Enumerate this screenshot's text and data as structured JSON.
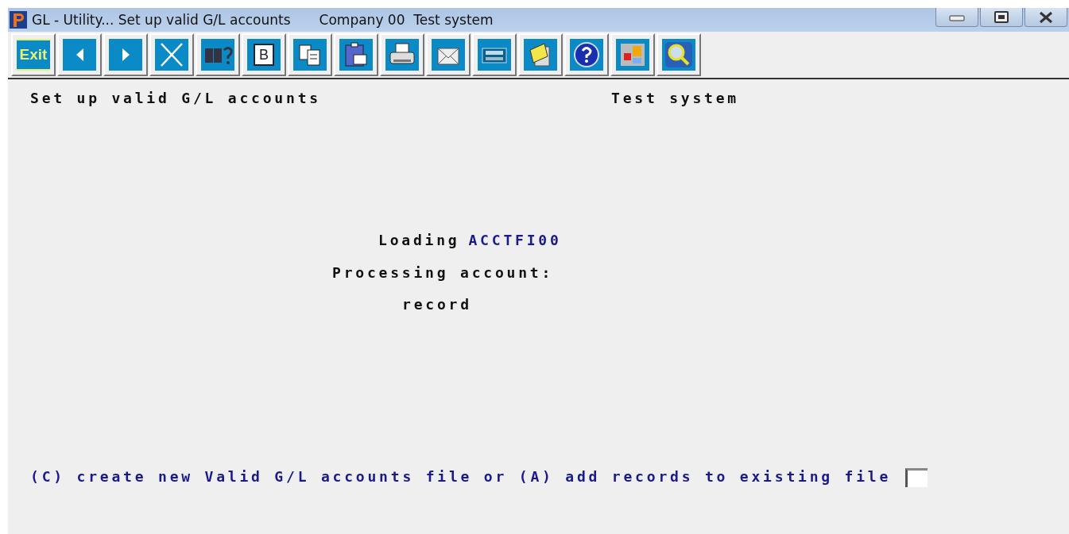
{
  "window": {
    "title": "GL - Utility... Set up valid G/L accounts",
    "company": "Company 00  Test system"
  },
  "toolbar": [
    {
      "kind": "text",
      "label": "Exit"
    },
    {
      "kind": "icon"
    },
    {
      "kind": "icon"
    },
    {
      "kind": "icon"
    },
    {
      "kind": "icon"
    },
    {
      "kind": "letter",
      "label": "B"
    },
    {
      "kind": "icon"
    },
    {
      "kind": "icon"
    },
    {
      "kind": "icon"
    },
    {
      "kind": "icon"
    },
    {
      "kind": "icon"
    },
    {
      "kind": "icon"
    },
    {
      "kind": "icon"
    },
    {
      "kind": "icon"
    },
    {
      "kind": "icon"
    }
  ],
  "screen": {
    "heading": "Set up valid G/L accounts",
    "system": "Test system",
    "loading_label": "Loading",
    "loading_file": "ACCTFI00",
    "processing": "Processing account:",
    "record": "record",
    "prompt": "(C) create new Valid G/L accounts file or (A) add records to existing file"
  }
}
